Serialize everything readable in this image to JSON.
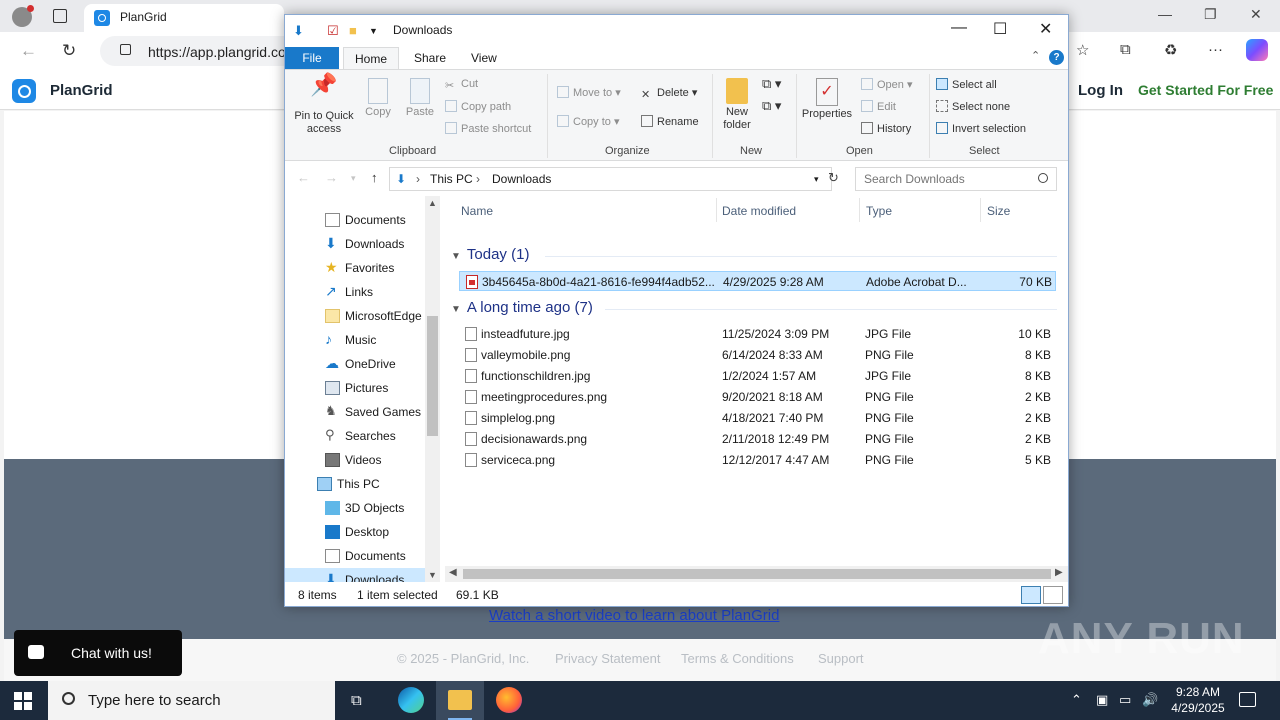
{
  "browser": {
    "tab_title": "PlanGrid",
    "url": "https://app.plangrid.co"
  },
  "page": {
    "brand": "PlanGrid",
    "login": "Log In",
    "get_started": "Get Started For Free",
    "video_link": "Watch a short video to learn about PlanGrid",
    "footer": {
      "copyright": "© 2025 - PlanGrid, Inc.",
      "privacy": "Privacy Statement",
      "terms": "Terms & Conditions",
      "support": "Support"
    },
    "chat_label": "Chat with us!",
    "watermark": "ANY RUN"
  },
  "explorer": {
    "title": "Downloads",
    "tabs": {
      "file": "File",
      "home": "Home",
      "share": "Share",
      "view": "View"
    },
    "ribbon": {
      "clipboard": {
        "label": "Clipboard",
        "pin": "Pin to Quick access",
        "copy": "Copy",
        "paste": "Paste",
        "cut": "Cut",
        "copy_path": "Copy path",
        "paste_shortcut": "Paste shortcut"
      },
      "organize": {
        "label": "Organize",
        "move_to": "Move to",
        "copy_to": "Copy to",
        "delete": "Delete",
        "rename": "Rename"
      },
      "new": {
        "label": "New",
        "new_folder": "New folder"
      },
      "open": {
        "label": "Open",
        "properties": "Properties",
        "open": "Open",
        "edit": "Edit",
        "history": "History"
      },
      "select": {
        "label": "Select",
        "select_all": "Select all",
        "select_none": "Select none",
        "invert": "Invert selection"
      }
    },
    "address": {
      "crumb1": "This PC",
      "crumb2": "Downloads"
    },
    "search_placeholder": "Search Downloads",
    "nav_items": [
      "Documents",
      "Downloads",
      "Favorites",
      "Links",
      "MicrosoftEdge",
      "Music",
      "OneDrive",
      "Pictures",
      "Saved Games",
      "Searches",
      "Videos",
      "This PC",
      "3D Objects",
      "Desktop",
      "Documents",
      "Downloads"
    ],
    "columns": {
      "name": "Name",
      "date": "Date modified",
      "type": "Type",
      "size": "Size"
    },
    "groups": {
      "today": "Today (1)",
      "long_ago": "A long time ago (7)"
    },
    "files_today": [
      {
        "name": "3b45645a-8b0d-4a21-8616-fe994f4adb52....",
        "date": "4/29/2025 9:28 AM",
        "type": "Adobe Acrobat D...",
        "size": "70 KB"
      }
    ],
    "files_old": [
      {
        "name": "insteadfuture.jpg",
        "date": "11/25/2024 3:09 PM",
        "type": "JPG File",
        "size": "10 KB"
      },
      {
        "name": "valleymobile.png",
        "date": "6/14/2024 8:33 AM",
        "type": "PNG File",
        "size": "8 KB"
      },
      {
        "name": "functionschildren.jpg",
        "date": "1/2/2024 1:57 AM",
        "type": "JPG File",
        "size": "8 KB"
      },
      {
        "name": "meetingprocedures.png",
        "date": "9/20/2021 8:18 AM",
        "type": "PNG File",
        "size": "2 KB"
      },
      {
        "name": "simplelog.png",
        "date": "4/18/2021 7:40 PM",
        "type": "PNG File",
        "size": "2 KB"
      },
      {
        "name": "decisionawards.png",
        "date": "2/11/2018 12:49 PM",
        "type": "PNG File",
        "size": "2 KB"
      },
      {
        "name": "serviceca.png",
        "date": "12/12/2017 4:47 AM",
        "type": "PNG File",
        "size": "5 KB"
      }
    ],
    "status": {
      "items": "8 items",
      "selected": "1 item selected",
      "size": "69.1 KB"
    }
  },
  "taskbar": {
    "search_placeholder": "Type here to search",
    "time": "9:28 AM",
    "date": "4/29/2025"
  }
}
